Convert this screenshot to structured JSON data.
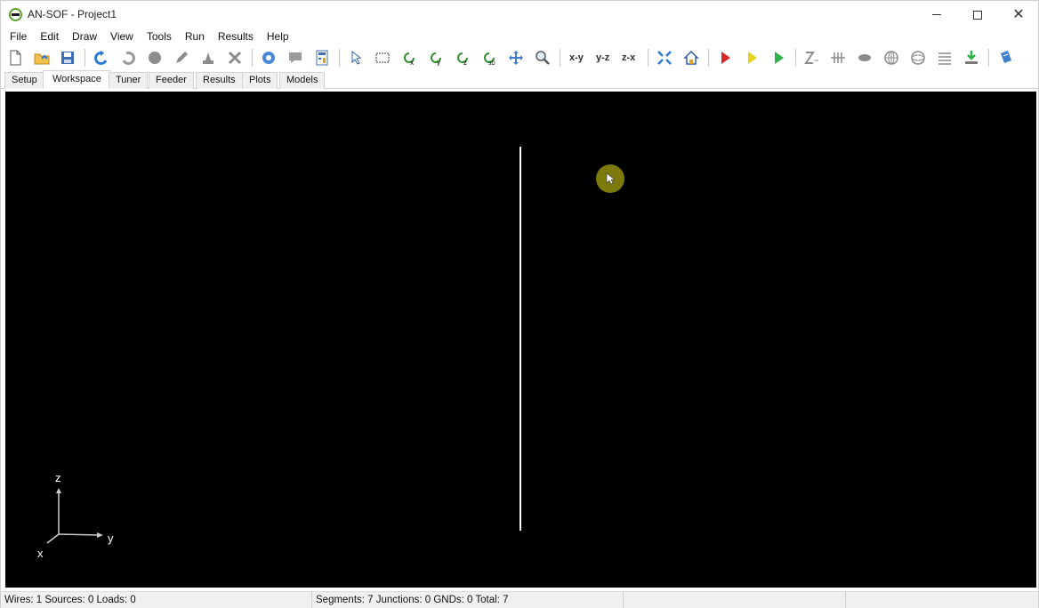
{
  "window": {
    "title": "AN-SOF - Project1",
    "controls": {
      "minimize": "minimize-icon",
      "maximize": "maximize-icon",
      "close": "close-icon",
      "close_glyph": "✕"
    }
  },
  "menu": [
    "File",
    "Edit",
    "Draw",
    "View",
    "Tools",
    "Run",
    "Results",
    "Help"
  ],
  "toolbar": {
    "view_labels": {
      "xy": "x-y",
      "yz": "y-z",
      "zx": "z-x"
    },
    "icons": [
      "new-file-icon",
      "open-folder-icon",
      "save-icon",
      "undo-icon",
      "redo-icon",
      "circle-icon",
      "pencil-icon",
      "paint-icon",
      "delete-icon",
      "settings-gear-icon",
      "comment-icon",
      "calculator-icon",
      "pointer-icon",
      "select-rect-icon",
      "rotate-x-icon",
      "rotate-y-icon",
      "rotate-z-icon",
      "rotate-3d-icon",
      "pan-icon",
      "zoom-icon",
      "fit-icon",
      "home-icon",
      "run-red-icon",
      "run-yellow-icon",
      "run-green-icon",
      "impedance-icon",
      "current-icon",
      "pattern-icon",
      "globe-icon",
      "globe-3d-icon",
      "table-icon",
      "export-icon",
      "book-icon"
    ]
  },
  "tabs": [
    {
      "label": "Setup",
      "active": false
    },
    {
      "label": "Workspace",
      "active": true
    },
    {
      "label": "Tuner",
      "active": false
    },
    {
      "label": "Feeder",
      "active": false
    },
    {
      "label": "Results",
      "active": false
    },
    {
      "label": "Plots",
      "active": false
    },
    {
      "label": "Models",
      "active": false
    }
  ],
  "workspace": {
    "background": "#000000",
    "wire_color": "#ffffff",
    "axes": {
      "z": "z",
      "y": "y",
      "x": "x"
    }
  },
  "status": {
    "left": "Wires: 1  Sources: 0  Loads: 0",
    "middle": "Segments: 7  Junctions: 0  GNDs: 0  Total: 7",
    "right": ""
  }
}
